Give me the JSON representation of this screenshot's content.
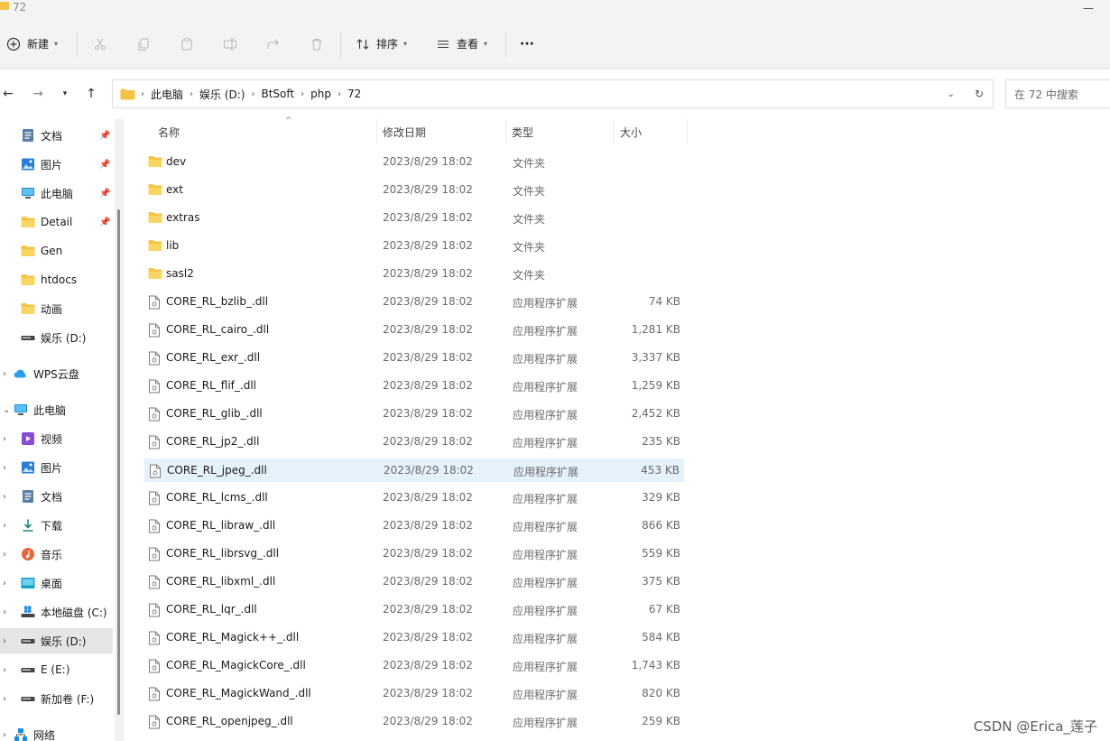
{
  "window": {
    "title": "72"
  },
  "toolbar": {
    "new_label": "新建",
    "sort_label": "排序",
    "view_label": "查看",
    "more_label": "···"
  },
  "address": {
    "crumbs": [
      "此电脑",
      "娱乐 (D:)",
      "BtSoft",
      "php",
      "72"
    ],
    "search_placeholder": "在 72 中搜索"
  },
  "sidebar": {
    "items": [
      {
        "label": "文档",
        "icon": "document-icon",
        "pinned": true
      },
      {
        "label": "图片",
        "icon": "pictures-icon",
        "pinned": true
      },
      {
        "label": "此电脑",
        "icon": "computer-icon",
        "pinned": true
      },
      {
        "label": "Detail",
        "icon": "folder-icon",
        "pinned": true
      },
      {
        "label": "Gen",
        "icon": "folder-icon"
      },
      {
        "label": "htdocs",
        "icon": "folder-icon"
      },
      {
        "label": "动画",
        "icon": "folder-icon"
      },
      {
        "label": "娱乐 (D:)",
        "icon": "drive-icon"
      },
      {
        "label": "WPS云盘",
        "icon": "cloud-icon"
      },
      {
        "label": "此电脑",
        "icon": "computer-icon"
      },
      {
        "label": "视频",
        "icon": "video-icon"
      },
      {
        "label": "图片",
        "icon": "pictures-icon"
      },
      {
        "label": "文档",
        "icon": "document-icon"
      },
      {
        "label": "下载",
        "icon": "download-icon"
      },
      {
        "label": "音乐",
        "icon": "music-icon"
      },
      {
        "label": "桌面",
        "icon": "desktop-icon"
      },
      {
        "label": "本地磁盘 (C:)",
        "icon": "windows-drive-icon"
      },
      {
        "label": "娱乐 (D:)",
        "icon": "drive-icon",
        "selected": true
      },
      {
        "label": "E (E:)",
        "icon": "drive-icon"
      },
      {
        "label": "新加卷 (F:)",
        "icon": "drive-icon"
      },
      {
        "label": "网络",
        "icon": "network-icon"
      }
    ]
  },
  "columns": {
    "name": "名称",
    "date": "修改日期",
    "type": "类型",
    "size": "大小"
  },
  "files": [
    {
      "name": "dev",
      "date": "2023/8/29 18:02",
      "type": "文件夹",
      "size": "",
      "kind": "folder"
    },
    {
      "name": "ext",
      "date": "2023/8/29 18:02",
      "type": "文件夹",
      "size": "",
      "kind": "folder"
    },
    {
      "name": "extras",
      "date": "2023/8/29 18:02",
      "type": "文件夹",
      "size": "",
      "kind": "folder"
    },
    {
      "name": "lib",
      "date": "2023/8/29 18:02",
      "type": "文件夹",
      "size": "",
      "kind": "folder"
    },
    {
      "name": "sasl2",
      "date": "2023/8/29 18:02",
      "type": "文件夹",
      "size": "",
      "kind": "folder"
    },
    {
      "name": "CORE_RL_bzlib_.dll",
      "date": "2023/8/29 18:02",
      "type": "应用程序扩展",
      "size": "74 KB",
      "kind": "file"
    },
    {
      "name": "CORE_RL_cairo_.dll",
      "date": "2023/8/29 18:02",
      "type": "应用程序扩展",
      "size": "1,281 KB",
      "kind": "file"
    },
    {
      "name": "CORE_RL_exr_.dll",
      "date": "2023/8/29 18:02",
      "type": "应用程序扩展",
      "size": "3,337 KB",
      "kind": "file"
    },
    {
      "name": "CORE_RL_flif_.dll",
      "date": "2023/8/29 18:02",
      "type": "应用程序扩展",
      "size": "1,259 KB",
      "kind": "file"
    },
    {
      "name": "CORE_RL_glib_.dll",
      "date": "2023/8/29 18:02",
      "type": "应用程序扩展",
      "size": "2,452 KB",
      "kind": "file"
    },
    {
      "name": "CORE_RL_jp2_.dll",
      "date": "2023/8/29 18:02",
      "type": "应用程序扩展",
      "size": "235 KB",
      "kind": "file"
    },
    {
      "name": "CORE_RL_jpeg_.dll",
      "date": "2023/8/29 18:02",
      "type": "应用程序扩展",
      "size": "453 KB",
      "kind": "file",
      "selected": true
    },
    {
      "name": "CORE_RL_lcms_.dll",
      "date": "2023/8/29 18:02",
      "type": "应用程序扩展",
      "size": "329 KB",
      "kind": "file"
    },
    {
      "name": "CORE_RL_libraw_.dll",
      "date": "2023/8/29 18:02",
      "type": "应用程序扩展",
      "size": "866 KB",
      "kind": "file"
    },
    {
      "name": "CORE_RL_librsvg_.dll",
      "date": "2023/8/29 18:02",
      "type": "应用程序扩展",
      "size": "559 KB",
      "kind": "file"
    },
    {
      "name": "CORE_RL_libxml_.dll",
      "date": "2023/8/29 18:02",
      "type": "应用程序扩展",
      "size": "375 KB",
      "kind": "file"
    },
    {
      "name": "CORE_RL_lqr_.dll",
      "date": "2023/8/29 18:02",
      "type": "应用程序扩展",
      "size": "67 KB",
      "kind": "file"
    },
    {
      "name": "CORE_RL_Magick++_.dll",
      "date": "2023/8/29 18:02",
      "type": "应用程序扩展",
      "size": "584 KB",
      "kind": "file"
    },
    {
      "name": "CORE_RL_MagickCore_.dll",
      "date": "2023/8/29 18:02",
      "type": "应用程序扩展",
      "size": "1,743 KB",
      "kind": "file"
    },
    {
      "name": "CORE_RL_MagickWand_.dll",
      "date": "2023/8/29 18:02",
      "type": "应用程序扩展",
      "size": "820 KB",
      "kind": "file"
    },
    {
      "name": "CORE_RL_openjpeg_.dll",
      "date": "2023/8/29 18:02",
      "type": "应用程序扩展",
      "size": "259 KB",
      "kind": "file"
    }
  ],
  "watermark": "CSDN @Erica_莲子",
  "colors": {
    "folder": "#f5c343",
    "selected_row": "#e5f1fb",
    "sidebar_selected": "#e5e5e5"
  }
}
